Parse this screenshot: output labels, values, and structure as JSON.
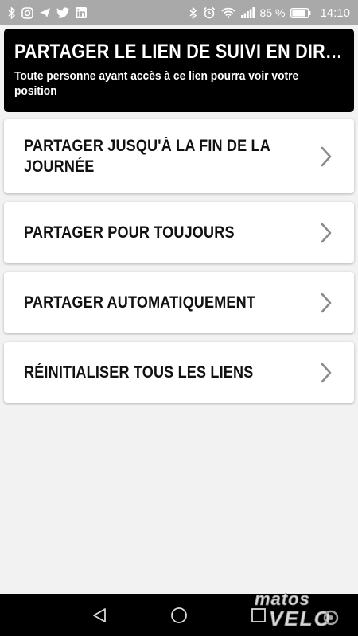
{
  "status_bar": {
    "left_icons": [
      "bluetooth-icon",
      "instagram-icon",
      "send-icon",
      "twitter-icon",
      "linkedin-icon"
    ],
    "right_icons": [
      "bluetooth-icon",
      "alarm-icon",
      "wifi-icon",
      "signal-icon"
    ],
    "battery_percent": "85 %",
    "battery_level": 0.85,
    "time": "14:10"
  },
  "header": {
    "title": "PARTAGER LE LIEN DE SUIVI EN DIR…",
    "subtitle": "Toute personne ayant accès à ce lien pourra voir votre position"
  },
  "options": [
    {
      "label": "PARTAGER JUSQU'À LA FIN DE LA JOURNÉE"
    },
    {
      "label": "PARTAGER POUR TOUJOURS"
    },
    {
      "label": "PARTAGER AUTOMATIQUEMENT"
    },
    {
      "label": "RÉINITIALISER TOUS LES LIENS"
    }
  ],
  "nav_bar": {
    "buttons": [
      "back-icon",
      "home-icon",
      "recents-icon"
    ]
  },
  "watermark": {
    "line1": "matos",
    "line2": "VELO"
  },
  "colors": {
    "status_bar": "#a9a9a9",
    "header_bg": "#000000",
    "page_bg": "#f2f2f2",
    "card_bg": "#ffffff",
    "chevron": "#8a8a8a"
  }
}
